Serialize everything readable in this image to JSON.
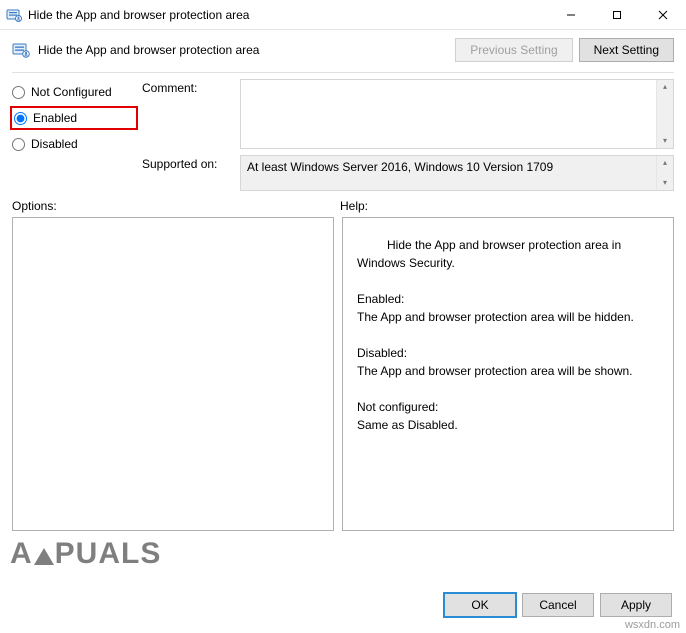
{
  "window": {
    "title": "Hide the App and browser protection area"
  },
  "header": {
    "policy_title": "Hide the App and browser protection area",
    "previous_label": "Previous Setting",
    "next_label": "Next Setting"
  },
  "state": {
    "not_configured_label": "Not Configured",
    "enabled_label": "Enabled",
    "disabled_label": "Disabled",
    "selected": "Enabled"
  },
  "comment": {
    "label": "Comment:",
    "value": ""
  },
  "supported": {
    "label": "Supported on:",
    "text": "At least Windows Server 2016, Windows 10 Version 1709"
  },
  "sections": {
    "options_label": "Options:",
    "help_label": "Help:"
  },
  "help_text": "Hide the App and browser protection area in Windows Security.\n\nEnabled:\nThe App and browser protection area will be hidden.\n\nDisabled:\nThe App and browser protection area will be shown.\n\nNot configured:\nSame as Disabled.",
  "footer": {
    "ok": "OK",
    "cancel": "Cancel",
    "apply": "Apply"
  },
  "watermarks": {
    "right": "wsxdn.com"
  }
}
